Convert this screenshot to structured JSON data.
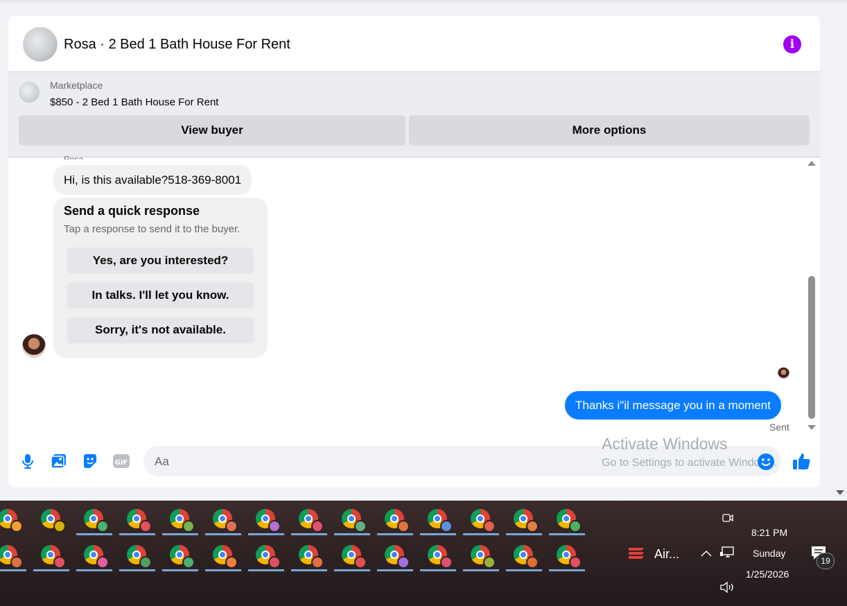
{
  "conversation": {
    "title": "Rosa · 2 Bed 1 Bath House For Rent",
    "info_icon": "info-icon"
  },
  "marketplace": {
    "label": "Marketplace",
    "listing": "$850 - 2 Bed 1 Bath House For Rent",
    "buttons": {
      "view_buyer": "View buyer",
      "more_options": "More options"
    }
  },
  "messages": {
    "sender_name": "Rosa",
    "incoming_text": "Hi, is this available?518-369-8001",
    "quick_response": {
      "title": "Send a quick response",
      "subtitle": "Tap a response to send it to the buyer.",
      "options": [
        "Yes, are you interested?",
        "In talks. I'll let you know.",
        "Sorry, it's not available."
      ]
    },
    "outgoing_text": "Thanks i\"il message you in a moment",
    "status": "Sent"
  },
  "composer": {
    "placeholder": "Aa",
    "icons": [
      "microphone-icon",
      "photo-icon",
      "sticker-icon",
      "gif-icon",
      "emoji-icon",
      "thumbs-up-icon"
    ],
    "gif_label": "GIF"
  },
  "watermark": {
    "line1": "Activate Windows",
    "line2": "Go to Settings to activate Windows."
  },
  "taskbar": {
    "app_label": "Air...",
    "time": "8:21 PM",
    "day": "Sunday",
    "date": "1/25/2026",
    "notification_count": "19",
    "row1_profile_colors": [
      "#f0a030",
      "#d8b000",
      "#48b070",
      "#e05060",
      "#78b050",
      "#e07050",
      "#b070d0",
      "#e05070",
      "#60b080",
      "#e07040",
      "#6090e0",
      "#e06050",
      "#e08040",
      "#50b060"
    ],
    "row2_profile_colors": [
      "#e07040",
      "#e05060",
      "#e060a0",
      "#50a060",
      "#48b070",
      "#f08040",
      "#e05060",
      "#e07040",
      "#e05050",
      "#a070e0",
      "#e05070",
      "#98b040",
      "#e07030",
      "#e05060"
    ]
  }
}
